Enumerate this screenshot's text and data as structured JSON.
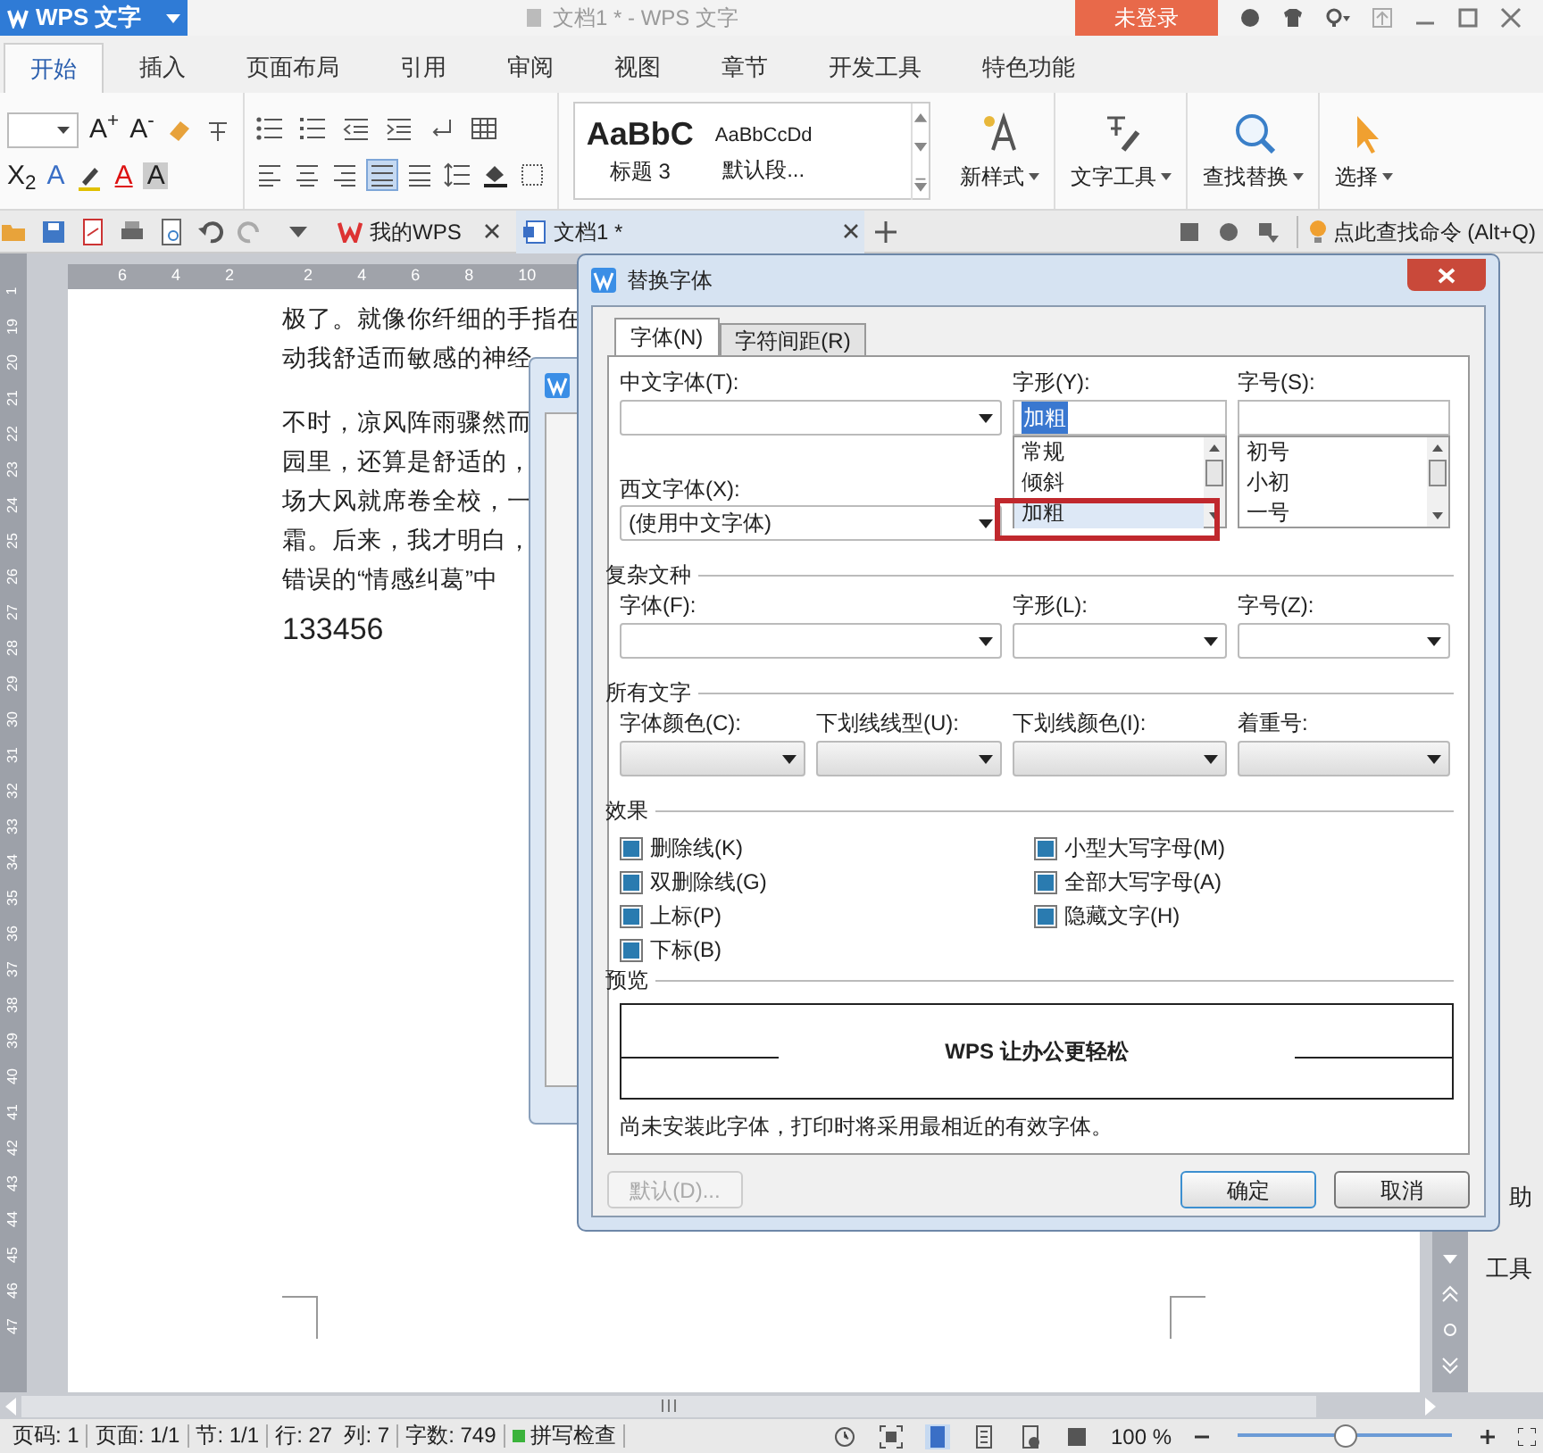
{
  "app_button": {
    "label": "WPS 文字"
  },
  "window": {
    "title": "文档1 * - WPS 文字"
  },
  "login_button": {
    "label": "未登录"
  },
  "ribbon_tabs": [
    {
      "label": "开始",
      "selected": true
    },
    {
      "label": "插入",
      "selected": false
    },
    {
      "label": "页面布局",
      "selected": false
    },
    {
      "label": "引用",
      "selected": false
    },
    {
      "label": "审阅",
      "selected": false
    },
    {
      "label": "视图",
      "selected": false
    },
    {
      "label": "章节",
      "selected": false
    },
    {
      "label": "开发工具",
      "selected": false
    },
    {
      "label": "特色功能",
      "selected": false
    }
  ],
  "ribbon": {
    "font_glyphs": [
      "A$^{+}$",
      "A$^{-}$",
      "X$_{2}$",
      "A",
      "A",
      "A"
    ],
    "styles": [
      {
        "sample": "AaBbC",
        "name": "标题 3"
      },
      {
        "sample": "AaBbCcDd",
        "name": "默认段..."
      }
    ],
    "big_buttons": [
      "新样式",
      "文字工具",
      "查找替换",
      "选择"
    ]
  },
  "doc_tabs": [
    {
      "label": "我的WPS",
      "selected": false
    },
    {
      "label": "文档1 *",
      "selected": true
    }
  ],
  "command_search": {
    "label": "点此查找命令 (Alt+Q)"
  },
  "ruler": {
    "horizontal": [
      "6",
      "4",
      "2",
      "2",
      "4",
      "6",
      "8",
      "10"
    ],
    "vertical": [
      "1",
      "19",
      "20",
      "21",
      "22",
      "23",
      "24",
      "25",
      "26",
      "27",
      "28",
      "29",
      "30",
      "31",
      "32",
      "33",
      "34",
      "35",
      "36",
      "37",
      "38",
      "39",
      "40",
      "41",
      "42",
      "43",
      "44",
      "45",
      "46",
      "47"
    ]
  },
  "document": {
    "paragraphs": [
      [
        "极了。就像你纤细的手指在",
        "动我舒适而敏感的神经"
      ],
      [
        "不时，凉风阵雨骤然而",
        "园里，还算是舒适的，",
        "场大风就席卷全校，一",
        "霜。后来，我才明白，",
        "错误的“情感纠葛”中"
      ]
    ],
    "number_line": "133456"
  },
  "dialog": {
    "title": "替换字体",
    "tabs": [
      {
        "label": "字体(N)",
        "selected": true
      },
      {
        "label": "字符间距(R)",
        "selected": false
      }
    ],
    "chinese_font": {
      "label": "中文字体(T):"
    },
    "style": {
      "label": "字形(Y):",
      "value": "加粗",
      "options": [
        {
          "label": "常规",
          "selected": false
        },
        {
          "label": "倾斜",
          "selected": false
        },
        {
          "label": "加粗",
          "selected": true
        }
      ]
    },
    "size": {
      "label": "字号(S):",
      "options": [
        {
          "label": "初号",
          "selected": false
        },
        {
          "label": "小初",
          "selected": false
        },
        {
          "label": "一号",
          "selected": false
        }
      ]
    },
    "western_font": {
      "label": "西文字体(X):",
      "value": "(使用中文字体)"
    },
    "complex": {
      "heading": "复杂文种",
      "fields": [
        {
          "label": "字体(F):"
        },
        {
          "label": "字形(L):"
        },
        {
          "label": "字号(Z):"
        }
      ]
    },
    "all_text": {
      "heading": "所有文字",
      "fields": [
        {
          "label": "字体颜色(C):"
        },
        {
          "label": "下划线线型(U):"
        },
        {
          "label": "下划线颜色(I):"
        },
        {
          "label": "着重号:"
        }
      ]
    },
    "effects": {
      "heading": "效果",
      "left": [
        {
          "label": "删除线(K)",
          "indeterminate": true
        },
        {
          "label": "双删除线(G)",
          "indeterminate": true
        },
        {
          "label": "上标(P)",
          "indeterminate": true
        },
        {
          "label": "下标(B)",
          "indeterminate": true
        }
      ],
      "right": [
        {
          "label": "小型大写字母(M)",
          "indeterminate": true
        },
        {
          "label": "全部大写字母(A)",
          "indeterminate": true
        },
        {
          "label": "隐藏文字(H)",
          "indeterminate": true
        }
      ]
    },
    "preview": {
      "heading": "预览",
      "sample": "WPS 让办公更轻松",
      "note": "尚未安装此字体，打印时将采用最相近的有效字体。"
    },
    "buttons": [
      {
        "label": "默认(D)...",
        "disabled": true,
        "default": false
      },
      {
        "label": "确定",
        "disabled": false,
        "default": true
      },
      {
        "label": "取消",
        "disabled": false,
        "default": false
      }
    ]
  },
  "side_panel": [
    "助",
    "工具"
  ],
  "status_bar": {
    "items": [
      "页码: 1",
      "页面: 1/1",
      "节: 1/1",
      "行: 27  列: 7",
      "字数: 749"
    ],
    "spell_check": "拼写检查",
    "zoom": "100 %",
    "zoom_level": {
      "level": 0.5
    }
  }
}
